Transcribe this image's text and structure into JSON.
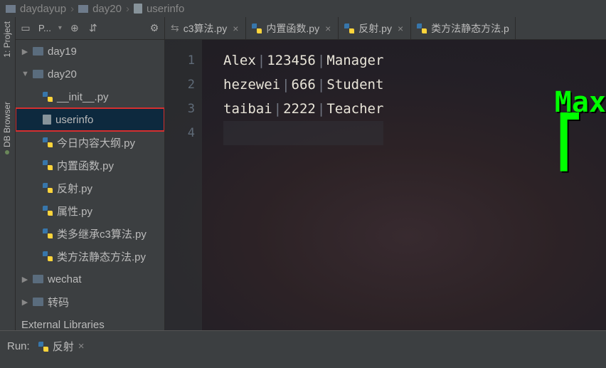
{
  "breadcrumb": {
    "root": "daydayup",
    "folder": "day20",
    "file": "userinfo"
  },
  "toolbar": {
    "project_label": "P..."
  },
  "vtabs": {
    "project": "1: Project",
    "db": "DB Browser"
  },
  "tree": {
    "day19": "day19",
    "day20": "day20",
    "files": {
      "init": "__init__.py",
      "userinfo": "userinfo",
      "outline": "今日内容大纲.py",
      "builtin": "内置函数.py",
      "reflect": "反射.py",
      "attr": "属性.py",
      "mro": "类多继承c3算法.py",
      "static": "类方法静态方法.py"
    },
    "wechat": "wechat",
    "trans": "转码",
    "ext": "External Libraries"
  },
  "tabs": {
    "t1": "c3算法.py",
    "t2": "内置函数.py",
    "t3": "反射.py",
    "t4": "类方法静态方法.p"
  },
  "editor": {
    "lines": [
      {
        "a": "Alex",
        "b": "123456",
        "c": "Manager"
      },
      {
        "a": "hezewei",
        "b": "666",
        "c": "Student"
      },
      {
        "a": "taibai",
        "b": "2222",
        "c": "Teacher"
      }
    ],
    "nums": {
      "n1": "1",
      "n2": "2",
      "n3": "3",
      "n4": "4"
    }
  },
  "watermark": {
    "line1": "Max"
  },
  "run": {
    "label": "Run:",
    "tab": "反射"
  }
}
